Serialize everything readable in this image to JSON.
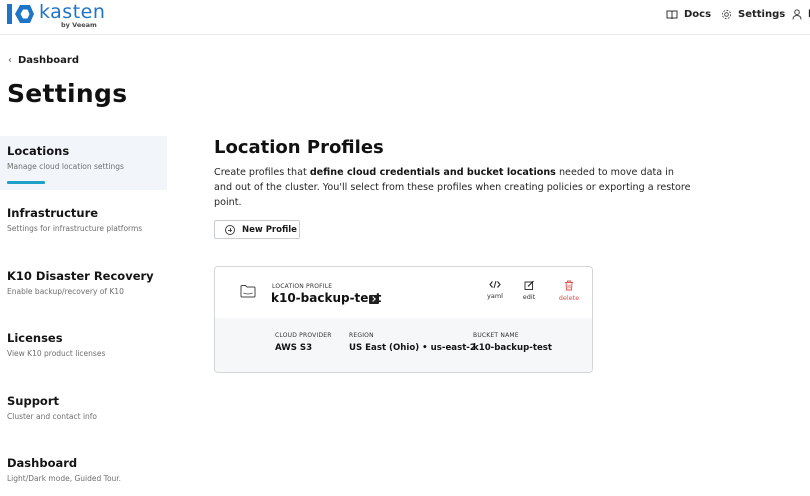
{
  "brand": {
    "name": "kasten",
    "sub": "by Veeam",
    "color": "#1e74c6"
  },
  "header": {
    "docs_label": "Docs",
    "settings_label": "Settings",
    "user_label": "k"
  },
  "breadcrumb": {
    "label": "Dashboard"
  },
  "page": {
    "title": "Settings"
  },
  "sidebar": {
    "accent": "#1fa0c8",
    "items": [
      {
        "title": "Locations",
        "desc": "Manage cloud location settings"
      },
      {
        "title": "Infrastructure",
        "desc": "Settings for infrastructure platforms"
      },
      {
        "title": "K10 Disaster Recovery",
        "desc": "Enable backup/recovery of K10"
      },
      {
        "title": "Licenses",
        "desc": "View K10 product licenses"
      },
      {
        "title": "Support",
        "desc": "Cluster and contact info"
      },
      {
        "title": "Dashboard",
        "desc": "Light/Dark mode, Guided Tour."
      }
    ]
  },
  "main": {
    "title": "Location Profiles",
    "desc_pre": "Create profiles that ",
    "desc_bold": "define cloud credentials and bucket locations",
    "desc_post": " needed to move data in and out of the cluster. You'll select from these profiles when creating policies or exporting a restore point.",
    "new_profile_label": "New Profile"
  },
  "profile_card": {
    "type_label": "LOCATION PROFILE",
    "name": "k10-backup-test",
    "actions": {
      "yaml": "yaml",
      "edit": "edit",
      "delete": "delete"
    },
    "delete_color": "#d9534f",
    "cloud_provider_label": "CLOUD PROVIDER",
    "cloud_provider": "AWS S3",
    "region_label": "REGION",
    "region": "US East (Ohio) • us-east-2",
    "bucket_label": "BUCKET NAME",
    "bucket": "k10-backup-test"
  }
}
